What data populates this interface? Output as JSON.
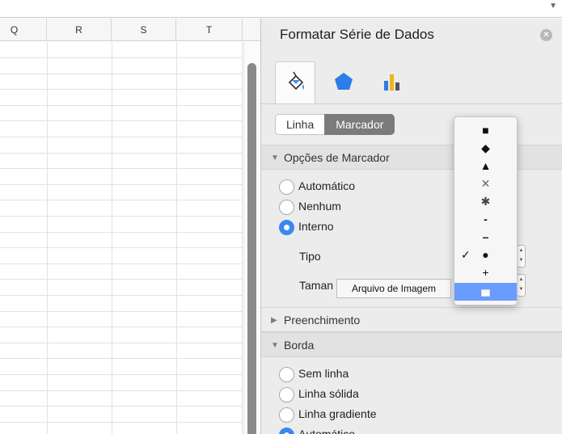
{
  "sheet": {
    "columns": [
      "Q",
      "R",
      "S",
      "T"
    ]
  },
  "panel": {
    "title": "Formatar Série de Dados",
    "close_icon": "close-icon",
    "icon_tabs": [
      {
        "name": "fill-line-icon",
        "active": true
      },
      {
        "name": "effects-pentagon-icon",
        "active": false
      },
      {
        "name": "series-options-bar-icon",
        "active": false
      }
    ],
    "segment": {
      "left": "Linha",
      "right": "Marcador",
      "selected": "Marcador"
    },
    "marker_options": {
      "title": "Opções de Marcador",
      "radios": [
        {
          "label": "Automático",
          "checked": false
        },
        {
          "label": "Nenhum",
          "checked": false
        },
        {
          "label": "Interno",
          "checked": true
        }
      ],
      "type_label": "Tipo",
      "size_label": "Taman"
    },
    "fill_section": "Preenchimento",
    "border_section": {
      "title": "Borda",
      "radios": [
        {
          "label": "Sem linha",
          "checked": false
        },
        {
          "label": "Linha sólida",
          "checked": false
        },
        {
          "label": "Linha gradiente",
          "checked": false
        },
        {
          "label": "Automático",
          "checked": true
        }
      ]
    }
  },
  "tooltip": "Arquivo de Imagem",
  "marker_menu": {
    "items": [
      {
        "glyph": "■",
        "icon": "square-marker-icon"
      },
      {
        "glyph": "◆",
        "icon": "diamond-marker-icon"
      },
      {
        "glyph": "▲",
        "icon": "triangle-marker-icon"
      },
      {
        "glyph": "✕",
        "icon": "x-marker-icon"
      },
      {
        "glyph": "✱",
        "icon": "star-marker-icon"
      },
      {
        "glyph": "-",
        "icon": "short-dash-marker-icon"
      },
      {
        "glyph": "–",
        "icon": "long-dash-marker-icon"
      },
      {
        "glyph": "●",
        "icon": "circle-marker-icon",
        "checked": true
      },
      {
        "glyph": "+",
        "icon": "plus-marker-icon"
      },
      {
        "glyph": "",
        "icon": "picture-marker-icon",
        "selected": true
      }
    ],
    "check_mark": "✓"
  },
  "colors": {
    "accent": "#3a88ee",
    "menu_highlight": "#6a9cff",
    "segment_selected": "#7b7b7b"
  }
}
